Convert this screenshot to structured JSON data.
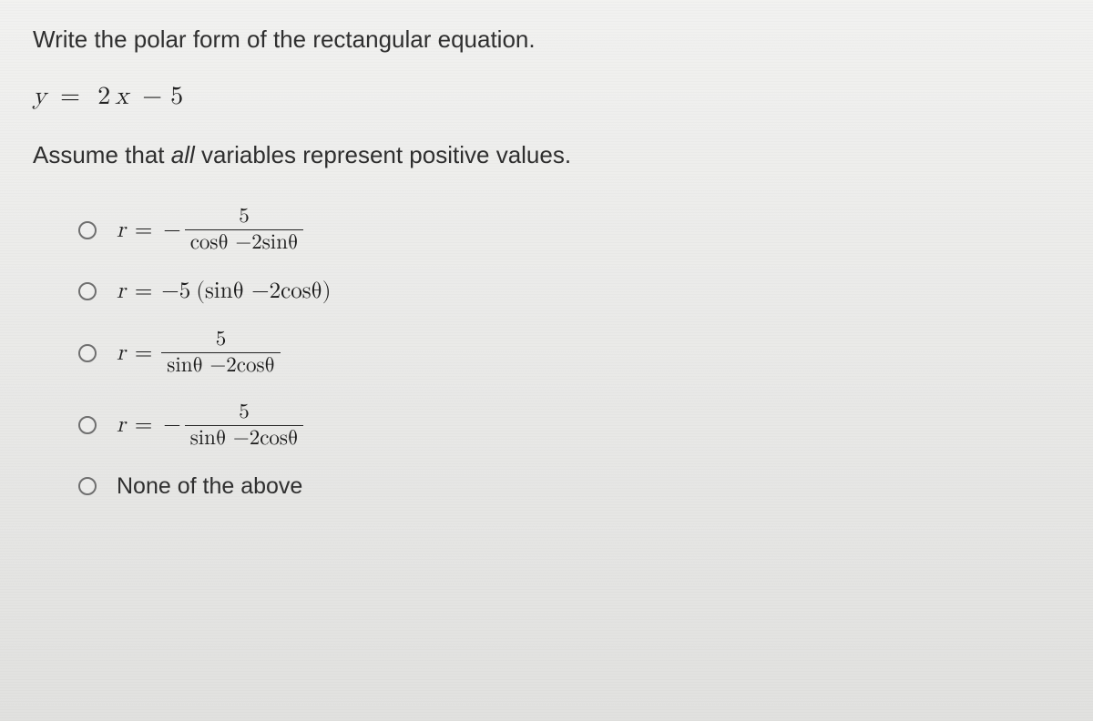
{
  "prompt": "Write the polar form of the rectangular equation.",
  "equation": {
    "lhs_var": "y",
    "eq": "=",
    "coef": "2",
    "rhs_var": "x",
    "minus": "−",
    "const": "5"
  },
  "assume": {
    "pre": "Assume that ",
    "ital": "all",
    "post": " variables represent positive values."
  },
  "opts": {
    "r": "r",
    "eq": "=",
    "neg": "−",
    "a": {
      "num": "5",
      "den": "cosθ −2sinθ"
    },
    "b": {
      "coef": "−5",
      "paren": "(sinθ −2cosθ)"
    },
    "c": {
      "num": "5",
      "den": "sinθ −2cosθ"
    },
    "d": {
      "num": "5",
      "den": "sinθ −2cosθ"
    },
    "e": "None of the above"
  },
  "chart_data": {
    "type": "table",
    "title": "Multiple choice: polar form of y = 2x − 5",
    "options": [
      "r = − 5 / (cosθ − 2sinθ)",
      "r = −5 (sinθ − 2cosθ)",
      "r = 5 / (sinθ − 2cosθ)",
      "r = − 5 / (sinθ − 2cosθ)",
      "None of the above"
    ],
    "selected": null
  }
}
